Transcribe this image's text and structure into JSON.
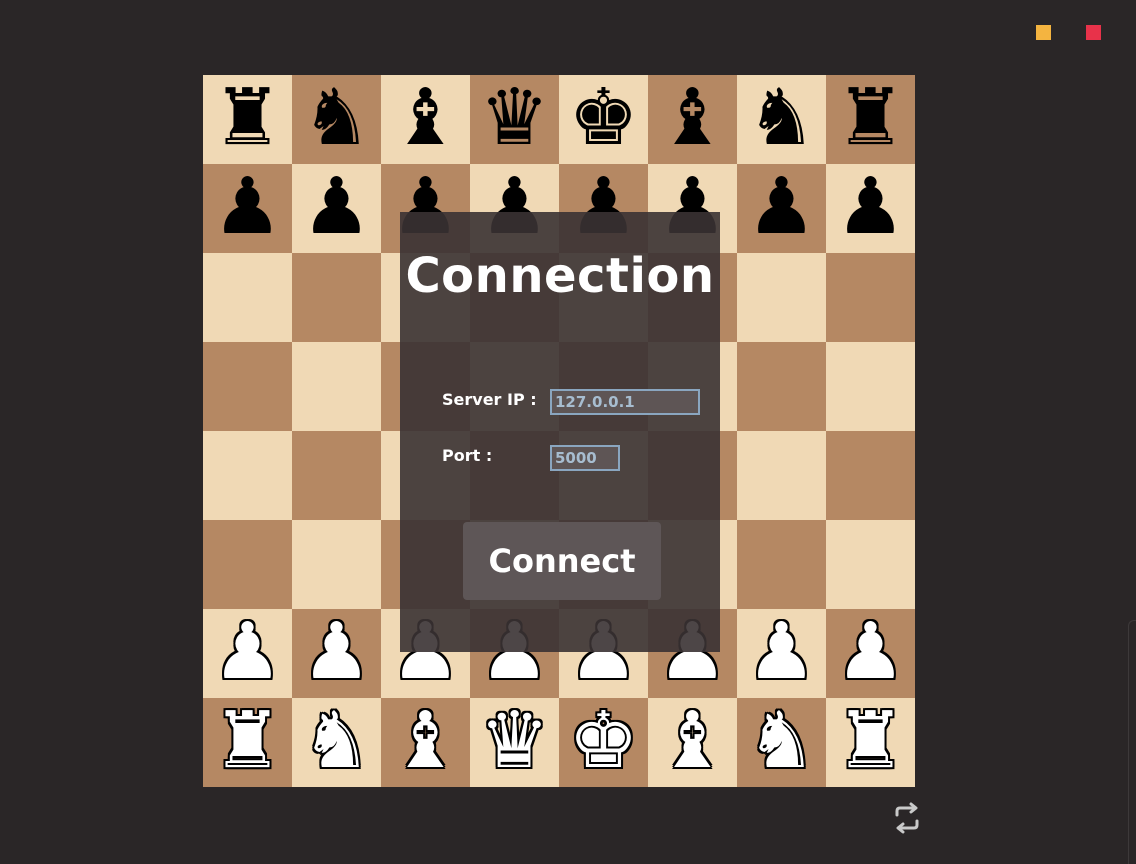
{
  "window": {
    "controls": [
      {
        "name": "minimize-button",
        "color": "#f4b440"
      },
      {
        "name": "close-button",
        "color": "#e8324a"
      }
    ]
  },
  "board": {
    "light_color": "#f0d9b5",
    "dark_color": "#b58863",
    "ranks": [
      [
        "r",
        "n",
        "b",
        "q",
        "k",
        "b",
        "n",
        "r"
      ],
      [
        "p",
        "p",
        "p",
        "p",
        "p",
        "p",
        "p",
        "p"
      ],
      [
        "",
        "",
        "",
        "",
        "",
        "",
        "",
        ""
      ],
      [
        "",
        "",
        "",
        "",
        "",
        "",
        "",
        ""
      ],
      [
        "",
        "",
        "",
        "",
        "",
        "",
        "",
        ""
      ],
      [
        "",
        "",
        "",
        "",
        "",
        "",
        "",
        ""
      ],
      [
        "P",
        "P",
        "P",
        "P",
        "P",
        "P",
        "P",
        "P"
      ],
      [
        "R",
        "N",
        "B",
        "Q",
        "K",
        "B",
        "N",
        "R"
      ]
    ]
  },
  "dialog": {
    "title": "Connection",
    "server_ip_label": "Server IP :",
    "server_ip_value": "127.0.0.1",
    "port_label": "Port :",
    "port_value": "5000",
    "connect_label": "Connect"
  },
  "footer": {
    "flip_icon": "flip-board-icon"
  }
}
